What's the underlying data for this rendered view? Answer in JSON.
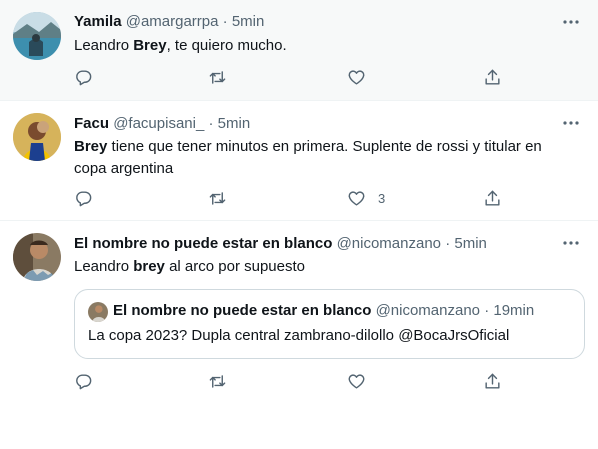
{
  "tweets": [
    {
      "name": "Yamila",
      "handle": "@amargarrpa",
      "separator": "·",
      "time": "5min",
      "text_parts": [
        "Leandro ",
        "Brey",
        ", te quiero mucho."
      ],
      "like_count": ""
    },
    {
      "name": "Facu",
      "handle": "@facupisani_",
      "separator": "·",
      "time": "5min",
      "text_parts": [
        "Brey",
        " tiene que tener minutos en primera. Suplente de rossi y titular en copa argentina"
      ],
      "like_count": "3"
    },
    {
      "name": "El nombre no puede estar en blanco",
      "handle": "@nicomanzano",
      "separator": "·",
      "time": "5min",
      "text_parts": [
        "Leandro ",
        "brey",
        " al arco por supuesto"
      ],
      "like_count": "",
      "quote": {
        "name": "El nombre no puede estar en blanco",
        "handle": "@nicomanzano",
        "separator": "·",
        "time": "19min",
        "text": "La copa 2023? Dupla central zambrano-dilollo @BocaJrsOficial"
      }
    }
  ],
  "icons": {
    "reply": "reply-icon",
    "retweet": "retweet-icon",
    "like": "heart-icon",
    "share": "share-icon",
    "more": "more-icon"
  },
  "colors": {
    "text": "#0f1419",
    "secondary": "#536471",
    "hover_background": "#f7f9f9",
    "divider": "#eff3f4",
    "quote_border": "#cfd9de"
  }
}
